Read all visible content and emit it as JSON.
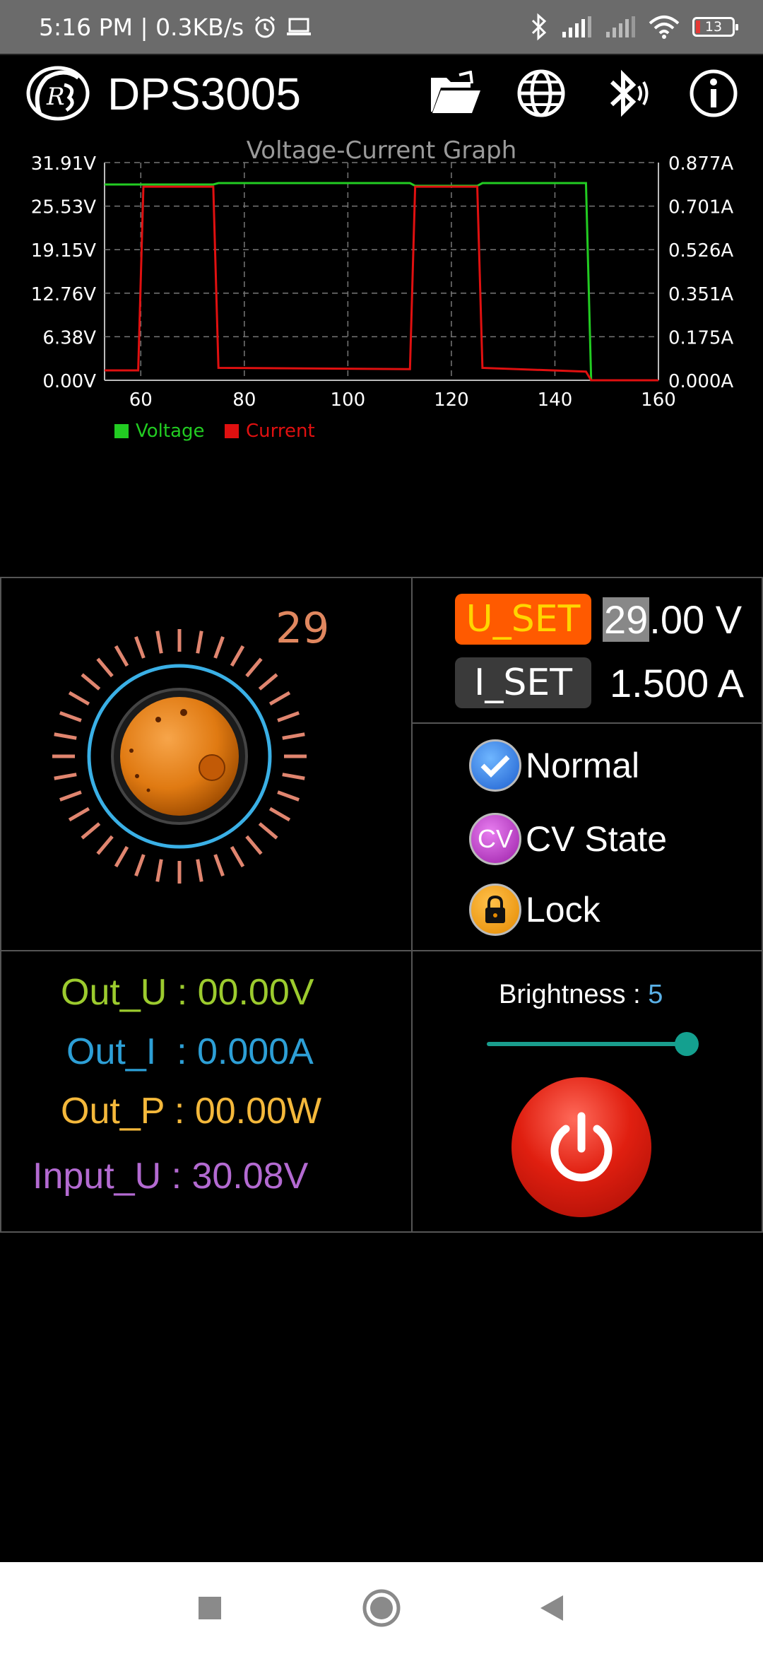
{
  "status_bar": {
    "time_speed": "5:16 PM | 0.3KB/s",
    "battery_level": "13"
  },
  "app": {
    "title": "DPS3005"
  },
  "chart_data": {
    "type": "line",
    "title": "Voltage-Current Graph",
    "x_ticks": [
      "60",
      "80",
      "100",
      "120",
      "140",
      "160"
    ],
    "xlim": [
      53,
      160
    ],
    "left_ticks": [
      "31.91V",
      "25.53V",
      "19.15V",
      "12.76V",
      "6.38V",
      "0.00V"
    ],
    "right_ticks": [
      "0.877A",
      "0.701A",
      "0.526A",
      "0.351A",
      "0.175A",
      "0.000A"
    ],
    "ylim_voltage": [
      0,
      31.91
    ],
    "ylim_current": [
      0,
      0.877
    ],
    "grid": true,
    "legend_position": "bottom-left",
    "series": [
      {
        "name": "Voltage",
        "color": "#22cc22",
        "axis": "left",
        "x": [
          53,
          74,
          75,
          112,
          113,
          125,
          126,
          146,
          147,
          160
        ],
        "y": [
          28.7,
          28.7,
          28.9,
          28.9,
          28.5,
          28.5,
          28.9,
          28.9,
          0.0,
          0.0
        ]
      },
      {
        "name": "Current",
        "color": "#e01010",
        "axis": "right",
        "x": [
          53,
          59.5,
          60.5,
          74,
          75,
          112,
          113,
          125,
          126,
          146,
          147,
          160
        ],
        "y": [
          0.04,
          0.04,
          0.78,
          0.78,
          0.05,
          0.045,
          0.78,
          0.78,
          0.05,
          0.035,
          0.0,
          0.0
        ]
      }
    ]
  },
  "dial": {
    "value": "29"
  },
  "settings": {
    "u_set_label": "U_SET",
    "u_set_highlight": "29",
    "u_set_rest": ".00 V",
    "i_set_label": "I_SET",
    "i_set_value": "1.500 A"
  },
  "states": {
    "normal_label": "Normal",
    "cv_icon": "CV",
    "cv_label": "CV State",
    "lock_label": "Lock"
  },
  "outputs": {
    "out_u": "Out_U : 00.00V",
    "out_i": "Out_I  : 0.000A",
    "out_p": "Out_P : 00.00W",
    "input_u": "Input_U : 30.08V",
    "colors": {
      "out_u": "#9ccb2e",
      "out_i": "#2d9fd6",
      "out_p": "#f4b83b",
      "input_u": "#b36ad1"
    }
  },
  "brightness": {
    "label": "Brightness : ",
    "value": "5",
    "level_fraction": 1.0
  }
}
